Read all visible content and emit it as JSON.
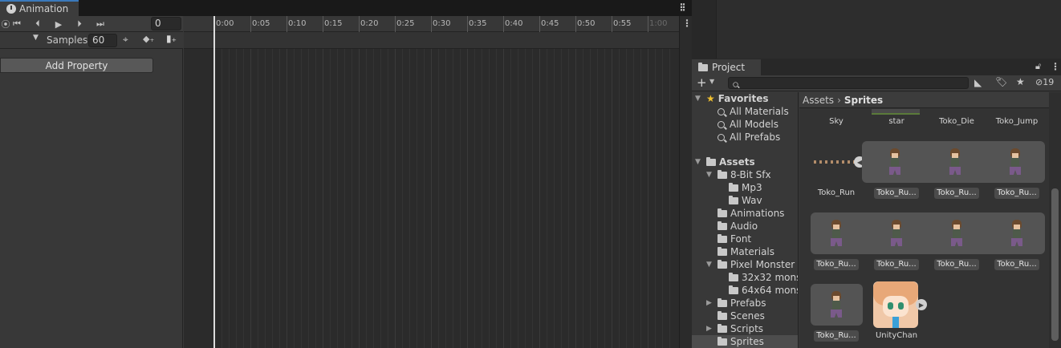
{
  "animation": {
    "tab_title": "Animation",
    "frame_value": "0",
    "samples_label": "Samples",
    "samples_value": "60",
    "add_property_label": "Add Property",
    "timeline_labels": [
      "0:00",
      "0:05",
      "0:10",
      "0:15",
      "0:20",
      "0:25",
      "0:30",
      "0:35",
      "0:40",
      "0:45",
      "0:50",
      "0:55",
      "1:00"
    ]
  },
  "project": {
    "tab_title": "Project",
    "visibility_count": "19",
    "breadcrumb": {
      "root": "Assets",
      "current": "Sprites"
    },
    "favorites": {
      "label": "Favorites",
      "items": [
        "All Materials",
        "All Models",
        "All Prefabs"
      ]
    },
    "tree": {
      "assets": "Assets",
      "bit_sfx": "8-Bit Sfx",
      "mp3": "Mp3",
      "wav": "Wav",
      "animations": "Animations",
      "audio": "Audio",
      "font": "Font",
      "materials": "Materials",
      "pixel_monster": "Pixel Monster P",
      "mons32": "32x32 mons",
      "mons64": "64x64 mons",
      "prefabs": "Prefabs",
      "scenes": "Scenes",
      "scripts": "Scripts",
      "sprites": "Sprites"
    },
    "assets_row1": [
      "Sky",
      "star",
      "Toko_Die",
      "Toko_Jump"
    ],
    "assets_row2": [
      "Toko_Run",
      "Toko_Ru...",
      "Toko_Ru...",
      "Toko_Ru..."
    ],
    "assets_row3": [
      "Toko_Ru...",
      "Toko_Ru...",
      "Toko_Ru...",
      "Toko_Ru..."
    ],
    "assets_row4": [
      "Toko_Ru...",
      "UnityChan"
    ]
  },
  "colors": {
    "accent": "#3a79bb",
    "playhead": "#dcdcdc",
    "favorite_star": "#f0c030"
  }
}
